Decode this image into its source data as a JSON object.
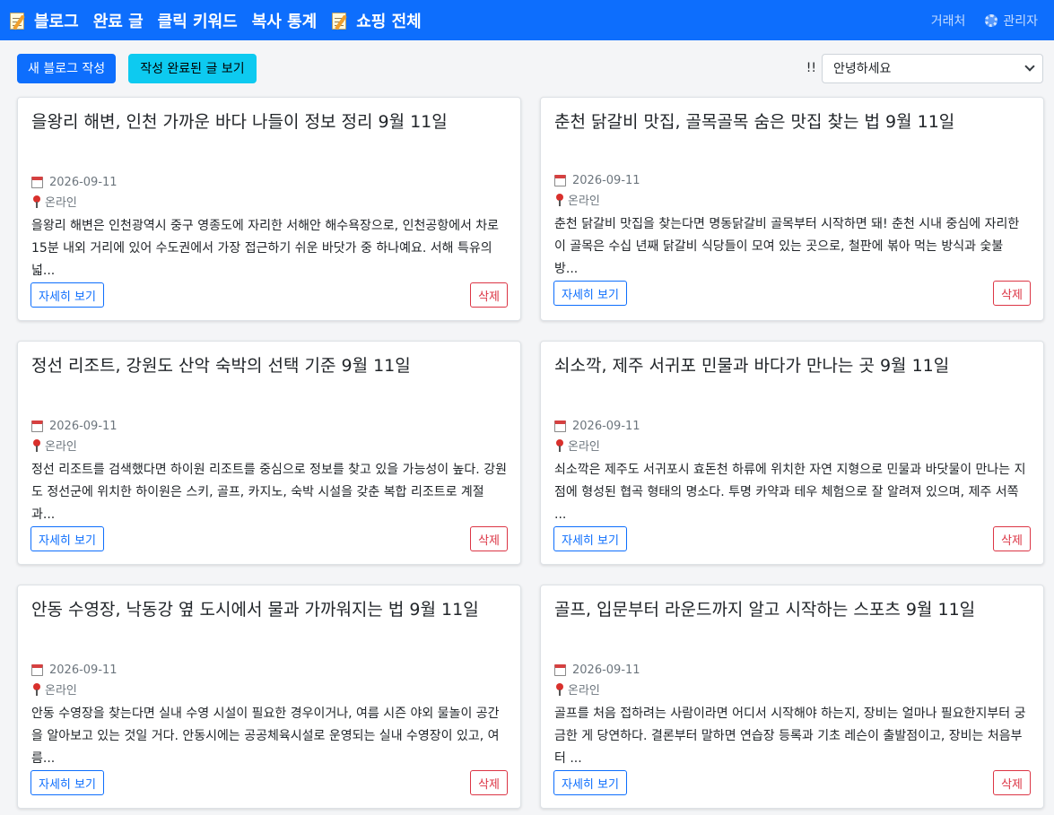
{
  "nav": {
    "items": [
      {
        "label": "블로그",
        "icon": "memo-icon"
      },
      {
        "label": "완료 글"
      },
      {
        "label": "클릭 키워드"
      },
      {
        "label": "복사 통계"
      },
      {
        "label": "쇼핑 전체",
        "icon": "memo-icon"
      }
    ],
    "right": {
      "vendor": "거래처",
      "admin": "관리자"
    }
  },
  "toolbar": {
    "new_blog": "새 블로그 작성",
    "view_completed": "작성 완료된 글 보기",
    "marker": "!!",
    "select_value": "안녕하세요"
  },
  "cards": [
    {
      "title": "을왕리 해변, 인천 가까운 바다 나들이 정보 정리 9월 11일",
      "date": "2026-09-11",
      "location": "온라인",
      "excerpt": "을왕리 해변은 인천광역시 중구 영종도에 자리한 서해안 해수욕장으로, 인천공항에서 차로 15분 내외 거리에 있어 수도권에서 가장 접근하기 쉬운 바닷가 중 하나예요. 서해 특유의 넓...",
      "detail": "자세히 보기",
      "delete": "삭제"
    },
    {
      "title": "춘천 닭갈비 맛집, 골목골목 숨은 맛집 찾는 법 9월 11일",
      "date": "2026-09-11",
      "location": "온라인",
      "excerpt": "춘천 닭갈비 맛집을 찾는다면 명동닭갈비 골목부터 시작하면 돼! 춘천 시내 중심에 자리한 이 골목은 수십 년째 닭갈비 식당들이 모여 있는 곳으로, 철판에 볶아 먹는 방식과 숯불 방...",
      "detail": "자세히 보기",
      "delete": "삭제"
    },
    {
      "title": "정선 리조트, 강원도 산악 숙박의 선택 기준 9월 11일",
      "date": "2026-09-11",
      "location": "온라인",
      "excerpt": "정선 리조트를 검색했다면 하이원 리조트를 중심으로 정보를 찾고 있을 가능성이 높다. 강원도 정선군에 위치한 하이원은 스키, 골프, 카지노, 숙박 시설을 갖춘 복합 리조트로 계절과...",
      "detail": "자세히 보기",
      "delete": "삭제"
    },
    {
      "title": "쇠소깍, 제주 서귀포 민물과 바다가 만나는 곳 9월 11일",
      "date": "2026-09-11",
      "location": "온라인",
      "excerpt": "쇠소깍은 제주도 서귀포시 효돈천 하류에 위치한 자연 지형으로 민물과 바닷물이 만나는 지점에 형성된 협곡 형태의 명소다. 투명 카약과 테우 체험으로 잘 알려져 있으며, 제주 서쪽 ...",
      "detail": "자세히 보기",
      "delete": "삭제"
    },
    {
      "title": "안동 수영장, 낙동강 옆 도시에서 물과 가까워지는 법 9월 11일",
      "date": "2026-09-11",
      "location": "온라인",
      "excerpt": "안동 수영장을 찾는다면 실내 수영 시설이 필요한 경우이거나, 여름 시즌 야외 물놀이 공간을 알아보고 있는 것일 거다. 안동시에는 공공체육시설로 운영되는 실내 수영장이 있고, 여름...",
      "detail": "자세히 보기",
      "delete": "삭제"
    },
    {
      "title": "골프, 입문부터 라운드까지 알고 시작하는 스포츠 9월 11일",
      "date": "2026-09-11",
      "location": "온라인",
      "excerpt": "골프를 처음 접하려는 사람이라면 어디서 시작해야 하는지, 장비는 얼마나 필요한지부터 궁금한 게 당연하다. 결론부터 말하면 연습장 등록과 기초 레슨이 출발점이고, 장비는 처음부터 ...",
      "detail": "자세히 보기",
      "delete": "삭제"
    }
  ]
}
